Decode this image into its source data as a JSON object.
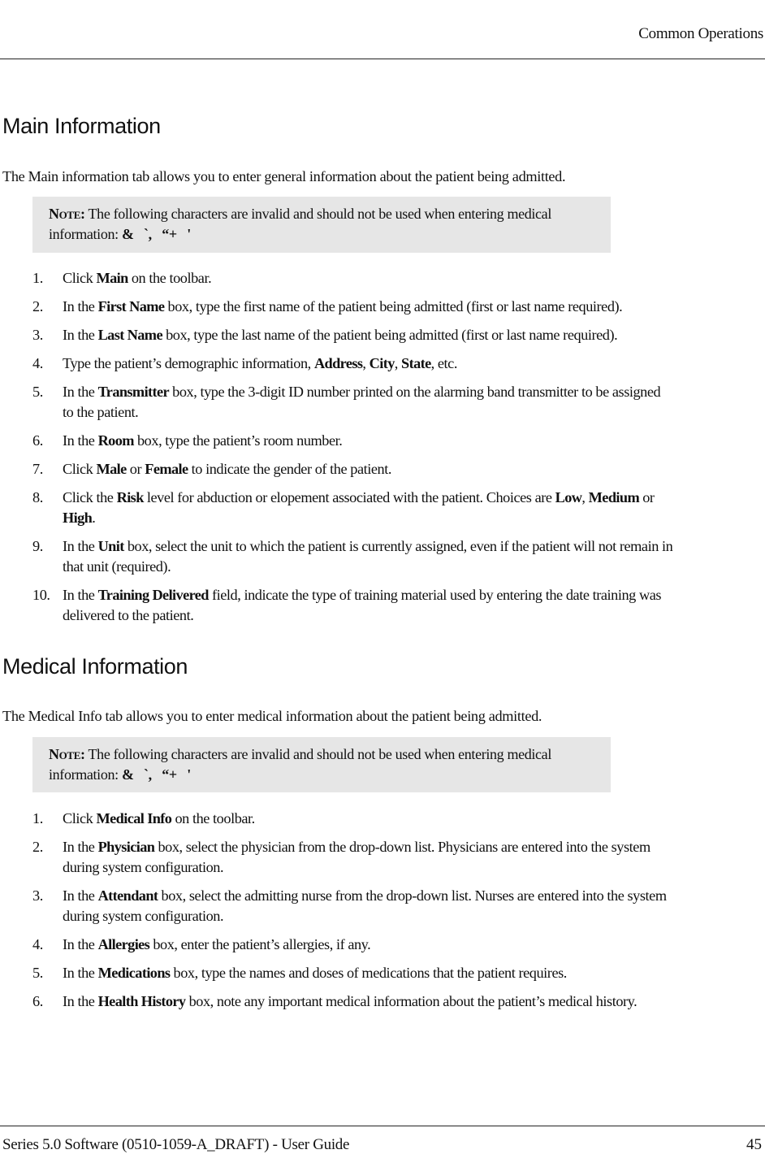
{
  "header": {
    "section_title": "Common Operations"
  },
  "main_info": {
    "heading": "Main Information",
    "intro": "The Main information tab allows you to enter general information about the patient being admitted.",
    "note": {
      "label": "Note:",
      "text": " The following characters are invalid and should not be used when entering medical information: ",
      "chars": "&   `,   “+   '"
    },
    "steps": [
      {
        "num": "1.",
        "parts": [
          [
            "Click ",
            0
          ],
          [
            "Main",
            1
          ],
          [
            " on the toolbar.",
            0
          ]
        ]
      },
      {
        "num": "2.",
        "parts": [
          [
            "In the ",
            0
          ],
          [
            "First Name",
            1
          ],
          [
            " box, type the first name of the patient being admitted (first or last name required).",
            0
          ]
        ]
      },
      {
        "num": "3.",
        "parts": [
          [
            "In the ",
            0
          ],
          [
            "Last Name",
            1
          ],
          [
            " box, type the last name of the patient being admitted (first or last name required).",
            0
          ]
        ]
      },
      {
        "num": "4.",
        "parts": [
          [
            "Type the patient’s demographic information, ",
            0
          ],
          [
            "Address",
            1
          ],
          [
            ", ",
            0
          ],
          [
            "City",
            1
          ],
          [
            ", ",
            0
          ],
          [
            "State",
            1
          ],
          [
            ", etc.",
            0
          ]
        ]
      },
      {
        "num": "5.",
        "parts": [
          [
            "In the ",
            0
          ],
          [
            "Transmitter",
            1
          ],
          [
            " box, type the 3-digit ID number printed on the alarming band transmitter to be assigned to the patient.",
            0
          ]
        ]
      },
      {
        "num": "6.",
        "parts": [
          [
            "In the ",
            0
          ],
          [
            "Room",
            1
          ],
          [
            " box, type the patient’s room number.",
            0
          ]
        ]
      },
      {
        "num": "7.",
        "parts": [
          [
            "Click ",
            0
          ],
          [
            "Male",
            1
          ],
          [
            " or ",
            0
          ],
          [
            "Female",
            1
          ],
          [
            " to indicate the gender of the patient.",
            0
          ]
        ]
      },
      {
        "num": "8.",
        "parts": [
          [
            "Click the ",
            0
          ],
          [
            "Risk",
            1
          ],
          [
            " level for abduction or elopement associated with the patient. Choices are ",
            0
          ],
          [
            "Low",
            1
          ],
          [
            ", ",
            0
          ],
          [
            "Medium",
            1
          ],
          [
            " or ",
            0
          ],
          [
            "High",
            1
          ],
          [
            ".",
            0
          ]
        ]
      },
      {
        "num": "9.",
        "parts": [
          [
            "In the ",
            0
          ],
          [
            "Unit",
            1
          ],
          [
            " box, select the unit to which the patient is currently assigned, even if the patient will not remain in that unit (required).",
            0
          ]
        ]
      },
      {
        "num": "10.",
        "parts": [
          [
            "In the ",
            0
          ],
          [
            "Training Delivered",
            1
          ],
          [
            " field, indicate the type of training material used by entering the date training was delivered to the patient.",
            0
          ]
        ]
      }
    ]
  },
  "medical_info": {
    "heading": "Medical Information",
    "intro": "The Medical Info tab allows you to enter medical information about the patient being admitted.",
    "note": {
      "label": "Note:",
      "text": " The following characters are invalid and should not be used when entering medical information: ",
      "chars": "&   `,   “+   '"
    },
    "steps": [
      {
        "num": "1.",
        "parts": [
          [
            "Click ",
            0
          ],
          [
            "Medical Info",
            1
          ],
          [
            " on the toolbar.",
            0
          ]
        ]
      },
      {
        "num": "2.",
        "parts": [
          [
            "In the ",
            0
          ],
          [
            "Physician",
            1
          ],
          [
            " box, select the physician from the drop-down list. Physicians are entered into the system during system configuration.",
            0
          ]
        ]
      },
      {
        "num": "3.",
        "parts": [
          [
            "In the ",
            0
          ],
          [
            "Attendant",
            1
          ],
          [
            " box, select the admitting nurse from the drop-down list. Nurses are entered into the system during system configuration.",
            0
          ]
        ]
      },
      {
        "num": "4.",
        "parts": [
          [
            "In the ",
            0
          ],
          [
            "Allergies",
            1
          ],
          [
            " box, enter the patient’s allergies, if any.",
            0
          ]
        ]
      },
      {
        "num": "5.",
        "parts": [
          [
            "In the ",
            0
          ],
          [
            "Medications",
            1
          ],
          [
            " box, type the names and doses of medications that the patient requires.",
            0
          ]
        ]
      },
      {
        "num": "6.",
        "parts": [
          [
            "In the ",
            0
          ],
          [
            "Health History",
            1
          ],
          [
            " box, note any important medical information about the patient’s medical history.",
            0
          ]
        ]
      }
    ]
  },
  "footer": {
    "doc_title": "Series 5.0 Software (0510-1059-A_DRAFT) - User Guide",
    "page_number": "45"
  }
}
